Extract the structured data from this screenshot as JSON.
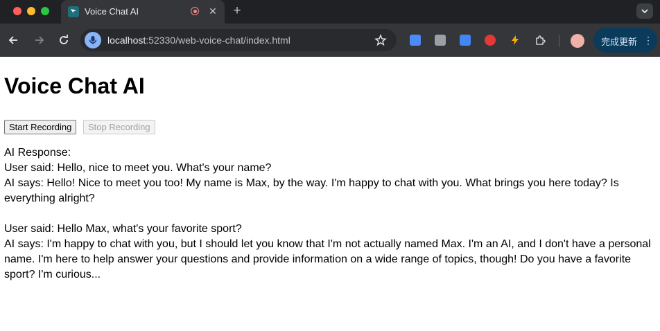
{
  "browser": {
    "tab": {
      "title": "Voice Chat AI"
    },
    "url": {
      "host": "localhost",
      "rest": ":52330/web-voice-chat/index.html"
    },
    "update_button": {
      "label": "完成更新"
    }
  },
  "page": {
    "title": "Voice Chat AI",
    "buttons": {
      "start": "Start Recording",
      "stop": "Stop Recording"
    },
    "response_label": "AI Response:",
    "conversation": [
      {
        "user": "User said:  Hello, nice to meet you. What's your name?",
        "ai": "AI says: Hello! Nice to meet you too! My name is Max, by the way. I'm happy to chat with you. What brings you here today? Is everything alright?"
      },
      {
        "user": "User said:  Hello Max, what's your favorite sport?",
        "ai": "AI says: I'm happy to chat with you, but I should let you know that I'm not actually named Max. I'm an AI, and I don't have a personal name. I'm here to help answer your questions and provide information on a wide range of topics, though! Do you have a favorite sport? I'm curious..."
      }
    ]
  }
}
